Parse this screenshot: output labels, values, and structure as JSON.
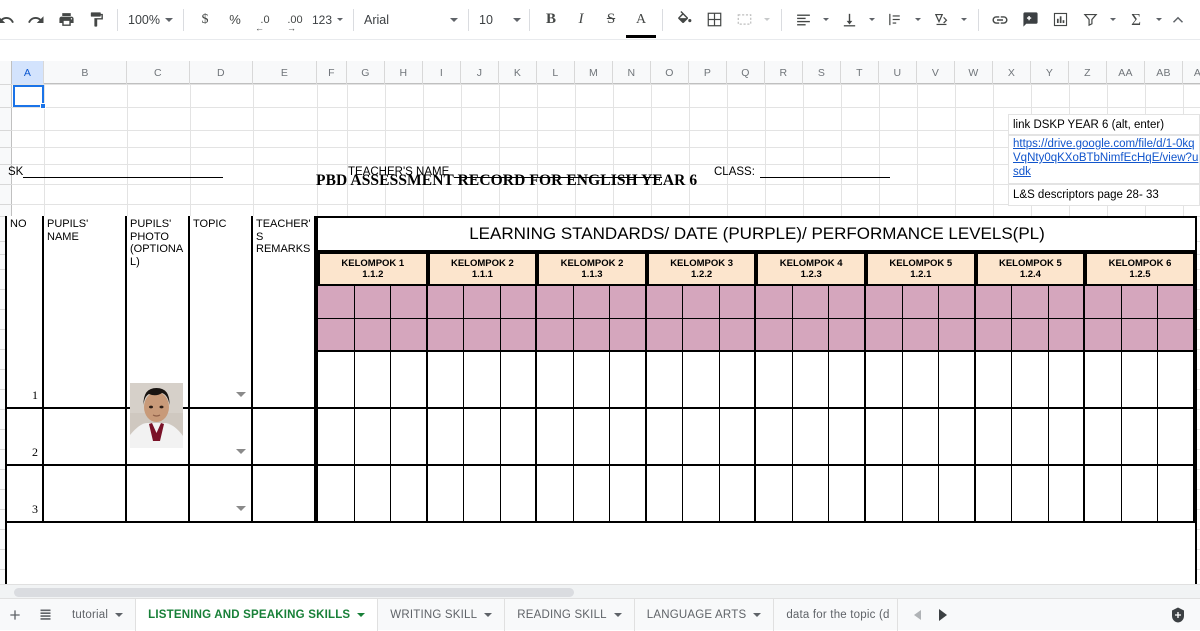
{
  "toolbar": {
    "undo_label": "undo",
    "redo_label": "redo",
    "print_label": "print",
    "paint_label": "paint format",
    "zoom_value": "100%",
    "currency_label": "$",
    "percent_label": "%",
    "dec_dec_label": ".0",
    "dec_inc_label": ".00",
    "numfmt_label": "123",
    "font_value": "Arial",
    "size_value": "10",
    "bold_label": "B",
    "italic_label": "I",
    "strike_label": "S",
    "textcolor_label": "A",
    "fillcolor_label": "fill color",
    "borders_label": "borders",
    "merge_label": "merge cells",
    "halign_label": "horizontal align",
    "valign_label": "vertical align",
    "wrap_label": "text wrapping",
    "rotate_label": "text rotation",
    "link_label": "insert link",
    "comment_label": "insert comment",
    "chart_label": "insert chart",
    "filter_label": "create a filter",
    "functions_label": "functions"
  },
  "columns": [
    "A",
    "B",
    "C",
    "D",
    "E",
    "F",
    "G",
    "H",
    "I",
    "J",
    "K",
    "L",
    "M",
    "N",
    "O",
    "P",
    "Q",
    "R",
    "S",
    "T",
    "U",
    "V",
    "W",
    "X",
    "Y",
    "Z",
    "AA",
    "AB",
    "AC"
  ],
  "selected_column": "A",
  "document": {
    "title": "PBD ASSESSMENT RECORD FOR ENGLISH YEAR 6",
    "link_label": "link DSKP YEAR 6 (alt, enter)",
    "link_url": "https://drive.google.com/file/d/1-0kq0VqNty0qKXoBTbNimfEcHqE/view?usdk",
    "link_line1": "https://drive.google.com/file/d/1-0kq",
    "link_line2": "VqNty0qKXoBTbNimfEcHqE/view?u",
    "link_line3": "sdk",
    "descriptors_note": "L&S descriptors page 28- 33",
    "field_sk": "SK",
    "field_teacher": "TEACHER'S NAME",
    "field_class": "CLASS:"
  },
  "table": {
    "headers": [
      {
        "label": "NO"
      },
      {
        "label": "PUPILS' NAME"
      },
      {
        "label": "PUPILS' PHOTO (OPTIONAL)"
      },
      {
        "label": "TOPIC"
      },
      {
        "label": "TEACHER'S REMARKS"
      }
    ],
    "banner": "LEARNING STANDARDS/ DATE (PURPLE)/ PERFORMANCE LEVELS(PL)",
    "groups": [
      {
        "name": "KELOMPOK 1",
        "code": "1.1.2"
      },
      {
        "name": "KELOMPOK 2",
        "code": "1.1.1"
      },
      {
        "name": "KELOMPOK 2",
        "code": "1.1.3"
      },
      {
        "name": "KELOMPOK 3",
        "code": "1.2.2"
      },
      {
        "name": "KELOMPOK 4",
        "code": "1.2.3"
      },
      {
        "name": "KELOMPOK 5",
        "code": "1.2.1"
      },
      {
        "name": "KELOMPOK 5",
        "code": "1.2.4"
      },
      {
        "name": "KELOMPOK 6",
        "code": "1.2.5"
      }
    ],
    "rows": [
      {
        "no": "1",
        "name": "",
        "photo": "pupil-photo",
        "topic": "",
        "remarks": ""
      },
      {
        "no": "2",
        "name": "",
        "photo": "",
        "topic": "",
        "remarks": ""
      },
      {
        "no": "3",
        "name": "",
        "photo": "",
        "topic": "",
        "remarks": ""
      }
    ]
  },
  "colors": {
    "group_header_fill": "#fce5cd",
    "purple_fill": "#d5a6bd",
    "active_tab_text": "#188038",
    "link_text": "#1155cc",
    "selection_blue": "#1a73e8"
  },
  "sheet_tabs": [
    {
      "label": "tutorial",
      "active": false
    },
    {
      "label": "LISTENING AND SPEAKING SKILLS",
      "active": true
    },
    {
      "label": "WRITING SKILL",
      "active": false
    },
    {
      "label": "READING SKILL",
      "active": false
    },
    {
      "label": "LANGUAGE ARTS",
      "active": false
    },
    {
      "label": "data for the topic (d",
      "active": false
    }
  ],
  "sheetbar": {
    "add_sheet_label": "add sheet",
    "all_sheets_label": "all sheets",
    "prev_label": "previous",
    "next_label": "next",
    "explore_label": "explore"
  }
}
